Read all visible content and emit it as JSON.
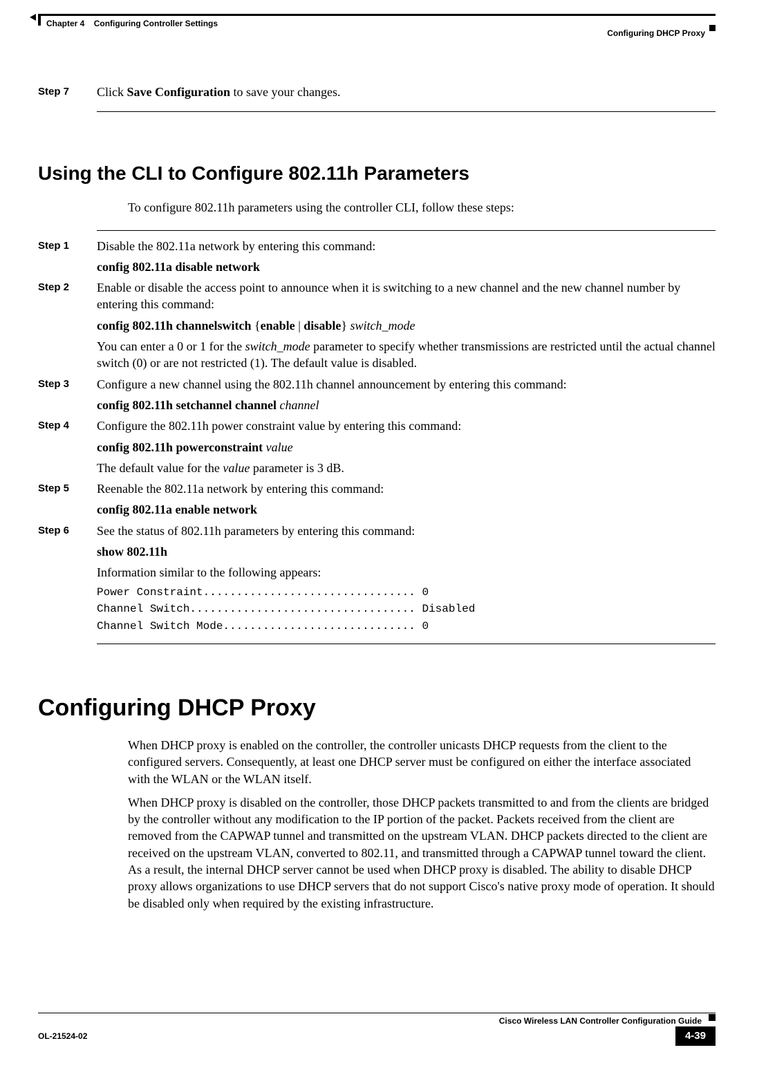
{
  "header": {
    "chapter": "Chapter 4",
    "chapterTitle": "Configuring Controller Settings",
    "sectionRight": "Configuring DHCP Proxy"
  },
  "top_step": {
    "label": "Step 7",
    "text_before": "Click ",
    "text_bold": "Save Configuration",
    "text_after": " to save your changes."
  },
  "cli_section": {
    "title": "Using the CLI to Configure 802.11h Parameters",
    "intro": "To configure 802.11h parameters using the controller CLI, follow these steps:",
    "steps": {
      "s1": {
        "label": "Step 1",
        "text": "Disable the 802.11a network by entering this command:",
        "cmd": "config 802.11a disable network"
      },
      "s2": {
        "label": "Step 2",
        "text": "Enable or disable the access point to announce when it is switching to a new channel and the new channel number by entering this command:",
        "cmd_p1": "config 802.11h channelswitch",
        "cmd_p2": "{",
        "cmd_p3": "enable",
        "cmd_p4": " | ",
        "cmd_p5": "disable",
        "cmd_p6": "}",
        "cmd_p7": " switch_mode",
        "note_p1": "You can enter a 0 or 1 for the ",
        "note_p2": "switch_mode",
        "note_p3": " parameter to specify whether transmissions are restricted until the actual channel switch (0) or are not restricted (1). The default value is disabled."
      },
      "s3": {
        "label": "Step 3",
        "text": "Configure a new channel using the 802.11h channel announcement by entering this command:",
        "cmd_p1": "config 802.11h setchannel channel",
        "cmd_p2": " channel"
      },
      "s4": {
        "label": "Step 4",
        "text": "Configure the 802.11h power constraint value by entering this command:",
        "cmd_p1": "config 802.11h powerconstraint",
        "cmd_p2": " value",
        "note_p1": "The default value for the ",
        "note_p2": "value",
        "note_p3": " parameter is 3 dB."
      },
      "s5": {
        "label": "Step 5",
        "text": "Reenable the 802.11a network by entering this command:",
        "cmd": "config 802.11a enable network"
      },
      "s6": {
        "label": "Step 6",
        "text": "See the status of 802.11h parameters by entering this command:",
        "cmd": "show 802.11h",
        "note": "Information similar to the following appears:",
        "output1": "Power Constraint................................ 0",
        "output2": "Channel Switch.................................. Disabled",
        "output3": "Channel Switch Mode............................. 0"
      }
    }
  },
  "dhcp_section": {
    "title": "Configuring DHCP Proxy",
    "para1": "When DHCP proxy is enabled on the controller, the controller unicasts DHCP requests from the client to the configured servers. Consequently, at least one DHCP server must be configured on either the interface associated with the WLAN or the WLAN itself.",
    "para2": "When DHCP proxy is disabled on the controller, those DHCP packets transmitted to and from the clients are bridged by the controller without any modification to the IP portion of the packet. Packets received from the client are removed from the CAPWAP tunnel and transmitted on the upstream VLAN. DHCP packets directed to the client are received on the upstream VLAN, converted to 802.11, and transmitted through a CAPWAP tunnel toward the client. As a result, the internal DHCP server cannot be used when DHCP proxy is disabled. The ability to disable DHCP proxy allows organizations to use DHCP servers that do not support Cisco's native proxy mode of operation. It should be disabled only when required by the existing infrastructure."
  },
  "footer": {
    "title": "Cisco Wireless LAN Controller Configuration Guide",
    "docnum": "OL-21524-02",
    "pagenum": "4-39"
  }
}
